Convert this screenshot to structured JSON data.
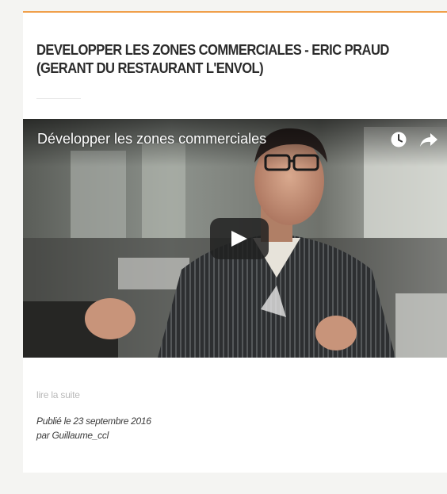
{
  "article": {
    "title": "DEVELOPPER LES ZONES COMMERCIALES - ERIC PRAUD (GERANT DU RESTAURANT L'ENVOL)",
    "read_more_label": "lire la suite",
    "published_label": "Publié le 23 septembre 2016",
    "author_label": "par Guillaume_ccl"
  },
  "video": {
    "title": "Développer les zones commerciales",
    "icons": {
      "watch_later": "clock-icon",
      "share": "share-arrow-icon",
      "play": "play-icon"
    }
  },
  "colors": {
    "accent_rule": "#f0a04b",
    "page_background": "#f4f4f2",
    "title_text": "#2b2b2b",
    "muted_link": "#b8b8b8"
  }
}
